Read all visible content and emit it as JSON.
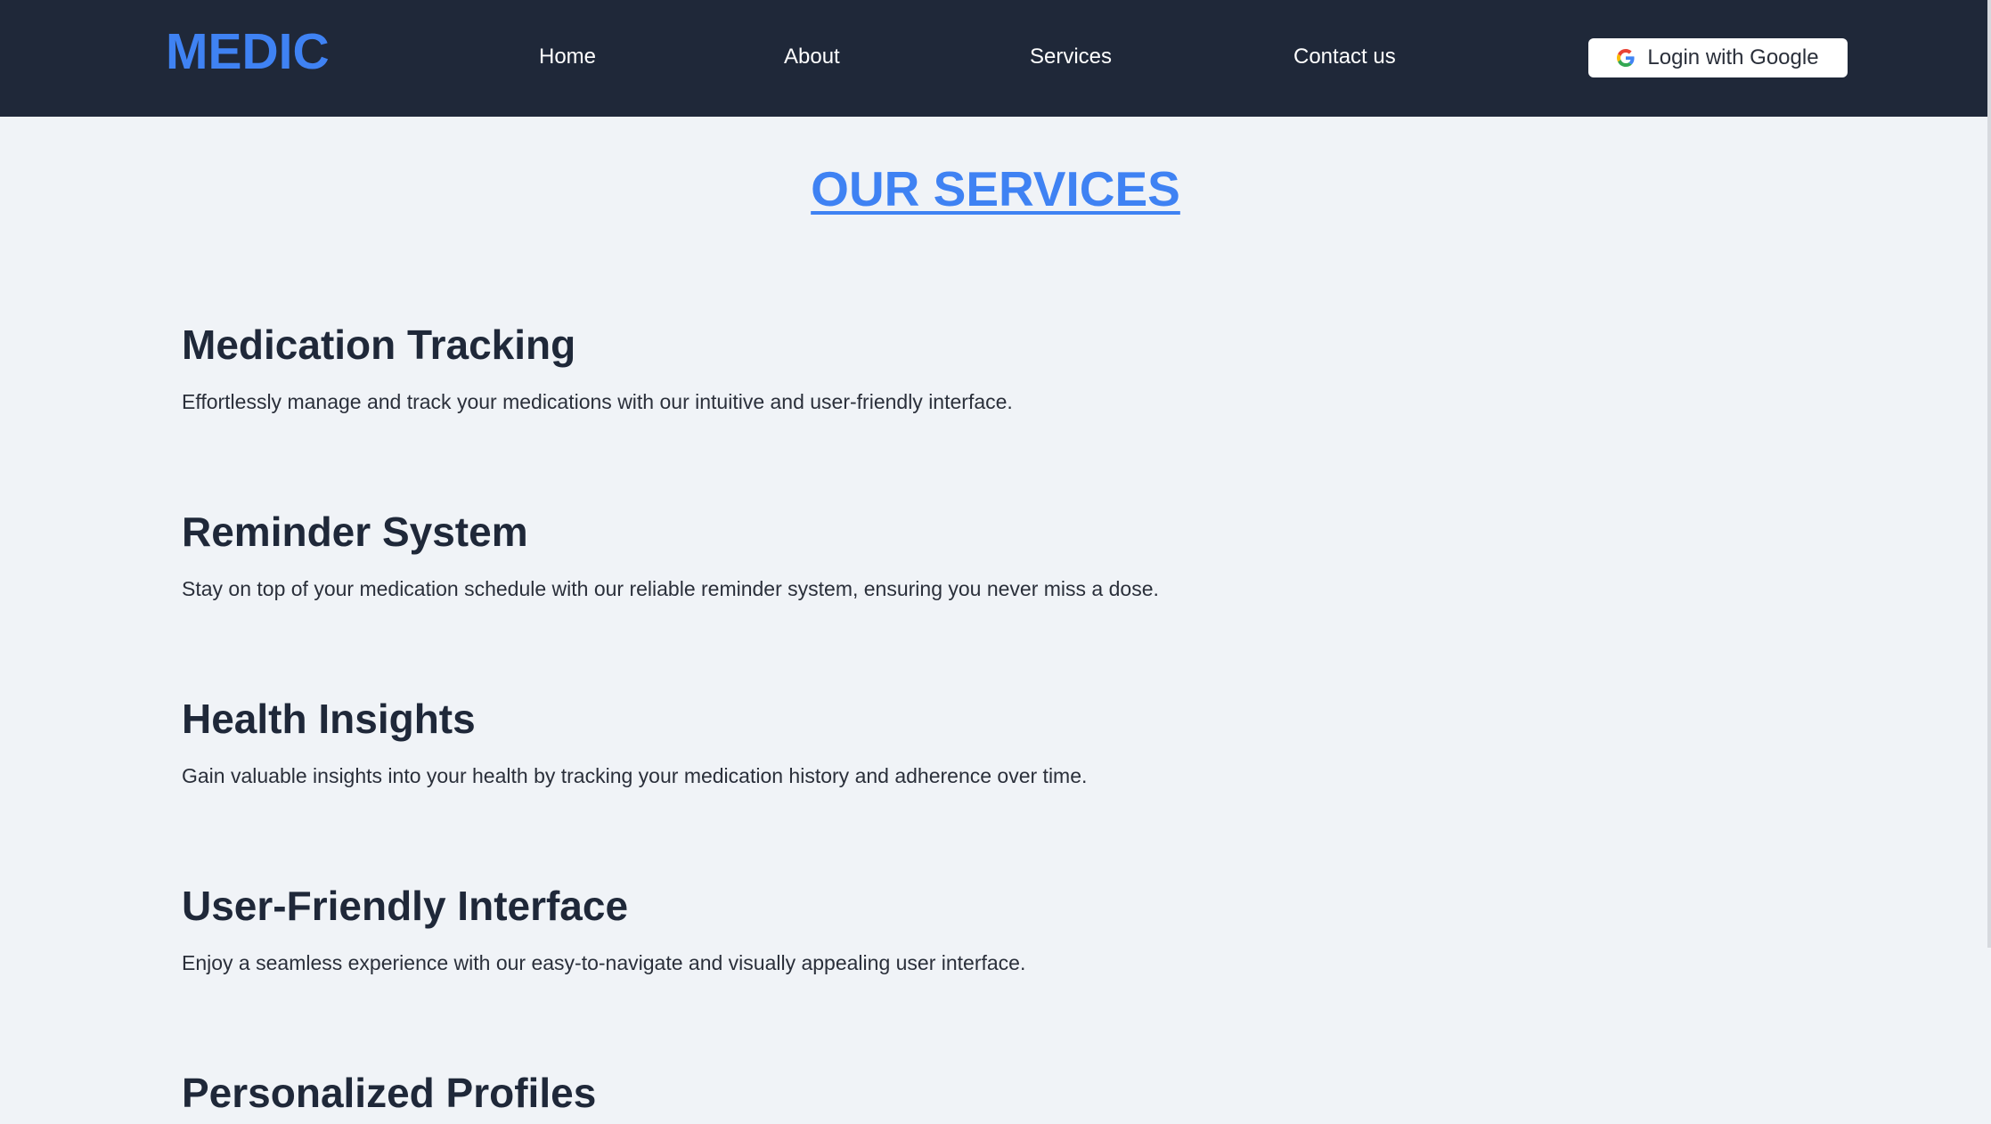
{
  "navbar": {
    "logo": "MEDIC",
    "links": [
      "Home",
      "About",
      "Services",
      "Contact us"
    ],
    "login_label": "Login with Google"
  },
  "main": {
    "title": "OUR SERVICES",
    "services": [
      {
        "heading": "Medication Tracking",
        "description": "Effortlessly manage and track your medications with our intuitive and user-friendly interface."
      },
      {
        "heading": "Reminder System",
        "description": "Stay on top of your medication schedule with our reliable reminder system, ensuring you never miss a dose."
      },
      {
        "heading": "Health Insights",
        "description": "Gain valuable insights into your health by tracking your medication history and adherence over time."
      },
      {
        "heading": "User-Friendly Interface",
        "description": "Enjoy a seamless experience with our easy-to-navigate and visually appealing user interface."
      },
      {
        "heading": "Personalized Profiles",
        "description": ""
      }
    ]
  },
  "colors": {
    "navbar_bg": "#1f2839",
    "accent": "#3f82f3",
    "page_bg": "#f0f3f7",
    "heading": "#1f2839"
  },
  "icons": {
    "login": "google-icon"
  }
}
